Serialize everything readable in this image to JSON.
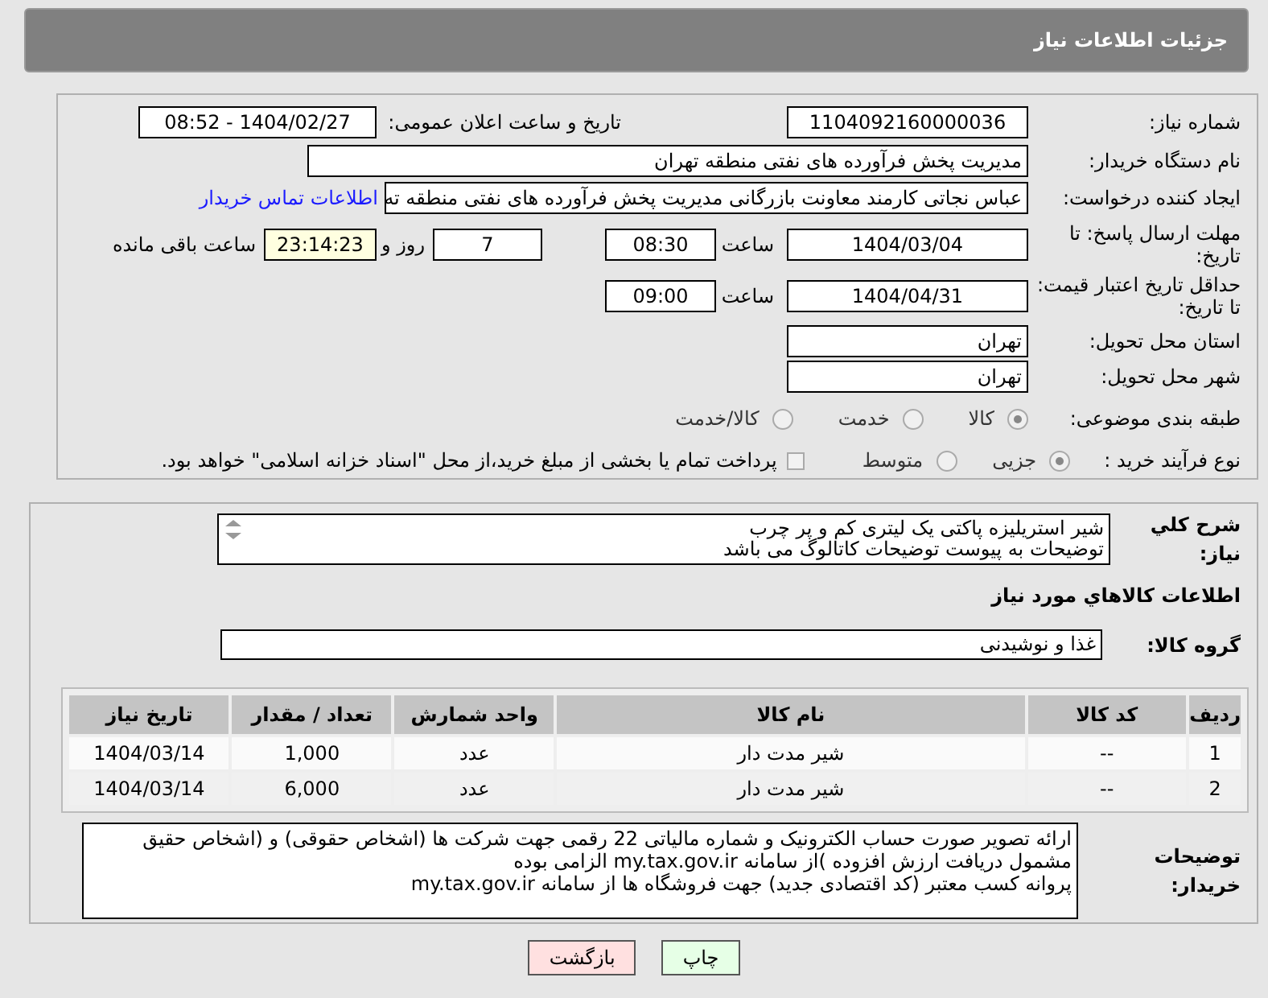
{
  "header": {
    "title": "جزئیات اطلاعات نیاز"
  },
  "need_number": {
    "label": "شماره نیاز:",
    "value": "1104092160000036"
  },
  "announce": {
    "label": "تاریخ و ساعت اعلان عمومی:",
    "value": "1404/02/27 - 08:52"
  },
  "buyer": {
    "label": "نام دستگاه خریدار:",
    "value": "مدیریت پخش فرآورده های نفتی منطقه تهران"
  },
  "creator": {
    "label": "ایجاد کننده درخواست:",
    "value": "عباس نجاتی کارمند معاونت بازرگانی مدیریت پخش فرآورده های نفتی منطقه ته",
    "link": "اطلاعات تماس خریدار"
  },
  "deadline": {
    "label": "مهلت ارسال پاسخ: تا تاریخ:",
    "date": "1404/03/04",
    "time_label": "ساعت",
    "time": "08:30",
    "days": "7",
    "days_label": "روز و",
    "remaining": "23:14:23",
    "remaining_label": "ساعت باقی مانده"
  },
  "validity": {
    "label": "حداقل تاریخ اعتبار قیمت: تا تاریخ:",
    "date": "1404/04/31",
    "time_label": "ساعت",
    "time": "09:00"
  },
  "province": {
    "label": "استان محل تحویل:",
    "value": "تهران"
  },
  "city": {
    "label": "شهر محل تحویل:",
    "value": "تهران"
  },
  "category": {
    "label": "طبقه بندی موضوعی:",
    "options": [
      {
        "label": "کالا",
        "selected": true
      },
      {
        "label": "خدمت",
        "selected": false
      },
      {
        "label": "کالا/خدمت",
        "selected": false
      }
    ]
  },
  "process": {
    "label": "نوع فرآیند خرید :",
    "options": [
      {
        "label": "جزیی",
        "selected": true
      },
      {
        "label": "متوسط",
        "selected": false
      }
    ],
    "treasury": {
      "checked": false,
      "label": "پرداخت تمام یا بخشی از مبلغ خرید،از محل \"اسناد خزانه اسلامی\" خواهد بود."
    }
  },
  "description": {
    "label": "شرح کلي نياز:",
    "lines": [
      "شیر استریلیزه پاکتی یک لیتری کم و پر چرب",
      "توضیحات به پیوست توضیحات کاتالوگ می باشد"
    ]
  },
  "goods_title": "اطلاعات کالاهاي مورد نياز",
  "goods_group": {
    "label": "گروه کالا:",
    "value": "غذا و نوشیدنی"
  },
  "table": {
    "columns": [
      "ردیف",
      "کد کالا",
      "نام کالا",
      "واحد شمارش",
      "تعداد / مقدار",
      "تاریخ نیاز"
    ],
    "rows": [
      [
        "1",
        "--",
        "شیر مدت دار",
        "عدد",
        "1,000",
        "1404/03/14"
      ],
      [
        "2",
        "--",
        "شیر مدت دار",
        "عدد",
        "6,000",
        "1404/03/14"
      ]
    ]
  },
  "buyer_notes": {
    "label": "توضیحات خریدار:",
    "lines": [
      "ارائه  تصویر صورت حساب الکترونیک و شماره مالیاتی 22 رقمی  جهت شرکت ها (اشخاص حقوقی) و (اشخاص حقیق",
      "مشمول دریافت ارزش افزوده )از سامانه my.tax.gov.ir  الزامی بوده",
      "پروانه کسب معتبر (کد اقتصادی جدید) جهت فروشگاه ها از سامانه my.tax.gov.ir"
    ]
  },
  "buttons": [
    {
      "kind": "print",
      "label": "چاپ"
    },
    {
      "kind": "back",
      "label": "بازگشت"
    }
  ]
}
